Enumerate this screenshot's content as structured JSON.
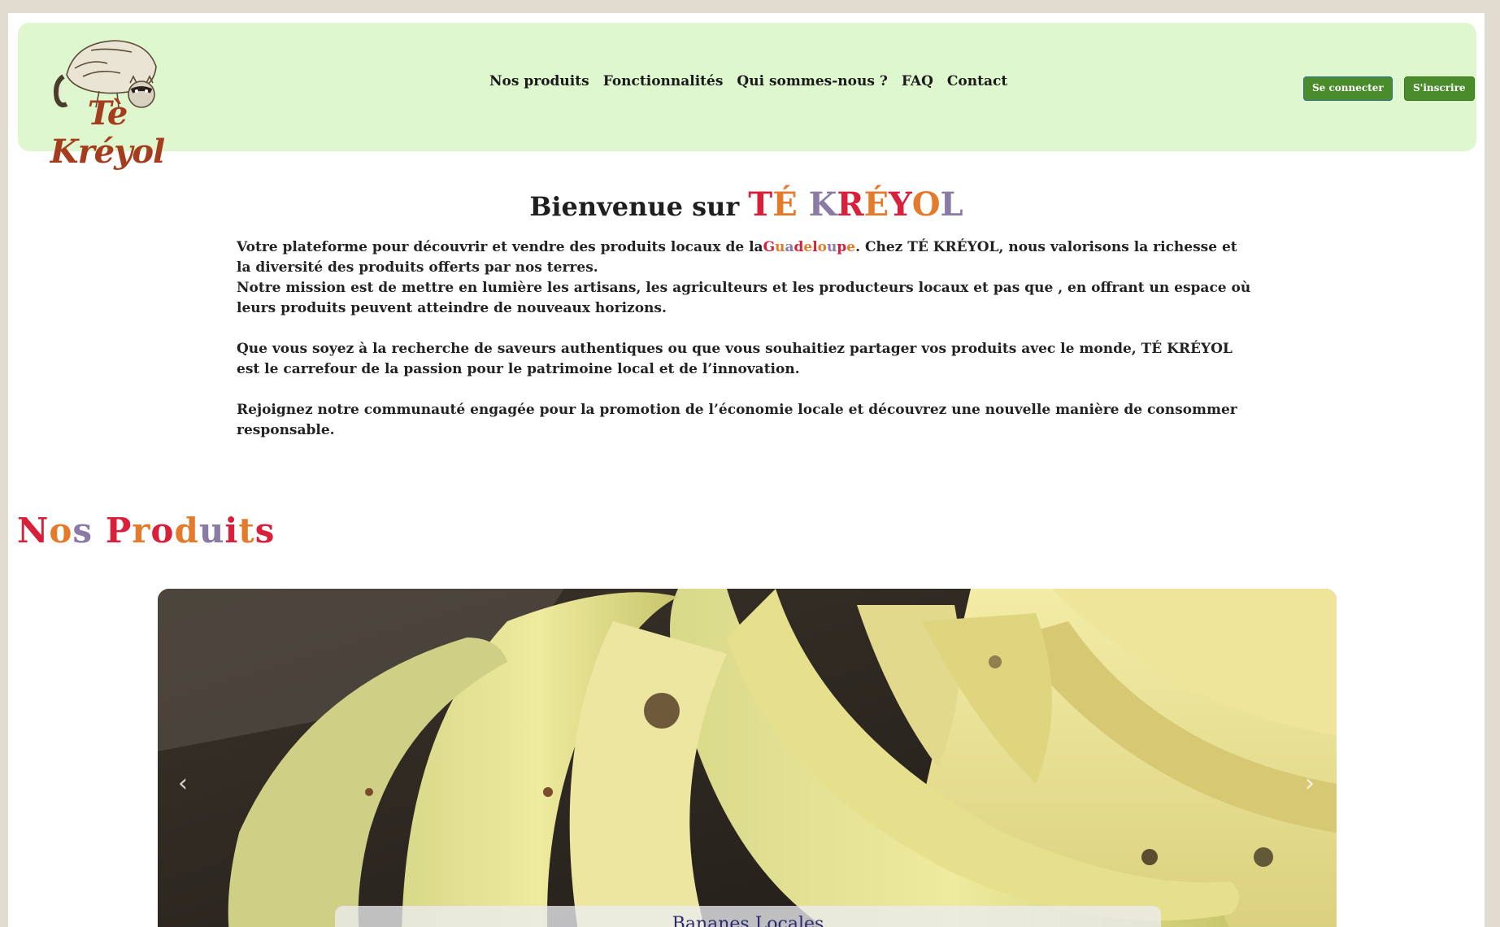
{
  "header": {
    "logo_text": "Tè Kréyol",
    "nav": [
      "Nos produits",
      "Fonctionnalités",
      "Qui sommes-nous ?",
      "FAQ",
      "Contact"
    ],
    "login_label": "Se connecter",
    "signup_label": "S'inscrire"
  },
  "intro": {
    "welcome_prefix": "Bienvenue sur",
    "brand": "TÉ KRÉYOL",
    "paragraph1_before": "Votre plateforme pour découvrir et vendre des produits locaux de la",
    "paragraph1_highlight": "Guadeloupe",
    "paragraph1_after": ". Chez TÉ KRÉYOL, nous valorisons la richesse et la diversité des produits offerts par nos terres.",
    "paragraph2": "Notre mission est de mettre en lumière les artisans, les agriculteurs et les producteurs locaux et pas que , en offrant un espace où leurs produits peuvent atteindre de nouveaux horizons.",
    "paragraph3": "Que vous soyez à la recherche de saveurs authentiques ou que vous souhaitiez partager vos produits avec le monde, TÉ KRÉYOL est le carrefour de la passion pour le patrimoine local et de l’innovation.",
    "paragraph4": "Rejoignez notre communauté engagée pour la promotion de l’économie locale et découvrez une nouvelle manière de consommer responsable."
  },
  "products": {
    "title": "Nos Produits",
    "slide_caption": "Bananes Locales",
    "prev_icon": "‹",
    "next_icon": "›"
  },
  "colors": {
    "header_bg": "#dff7cf",
    "button_green": "#4a8b2c",
    "brand_red": "#d8203a",
    "brand_orange": "#e47a2c",
    "brand_purple": "#8a7aa6",
    "logo_brown": "#a63c1e"
  }
}
